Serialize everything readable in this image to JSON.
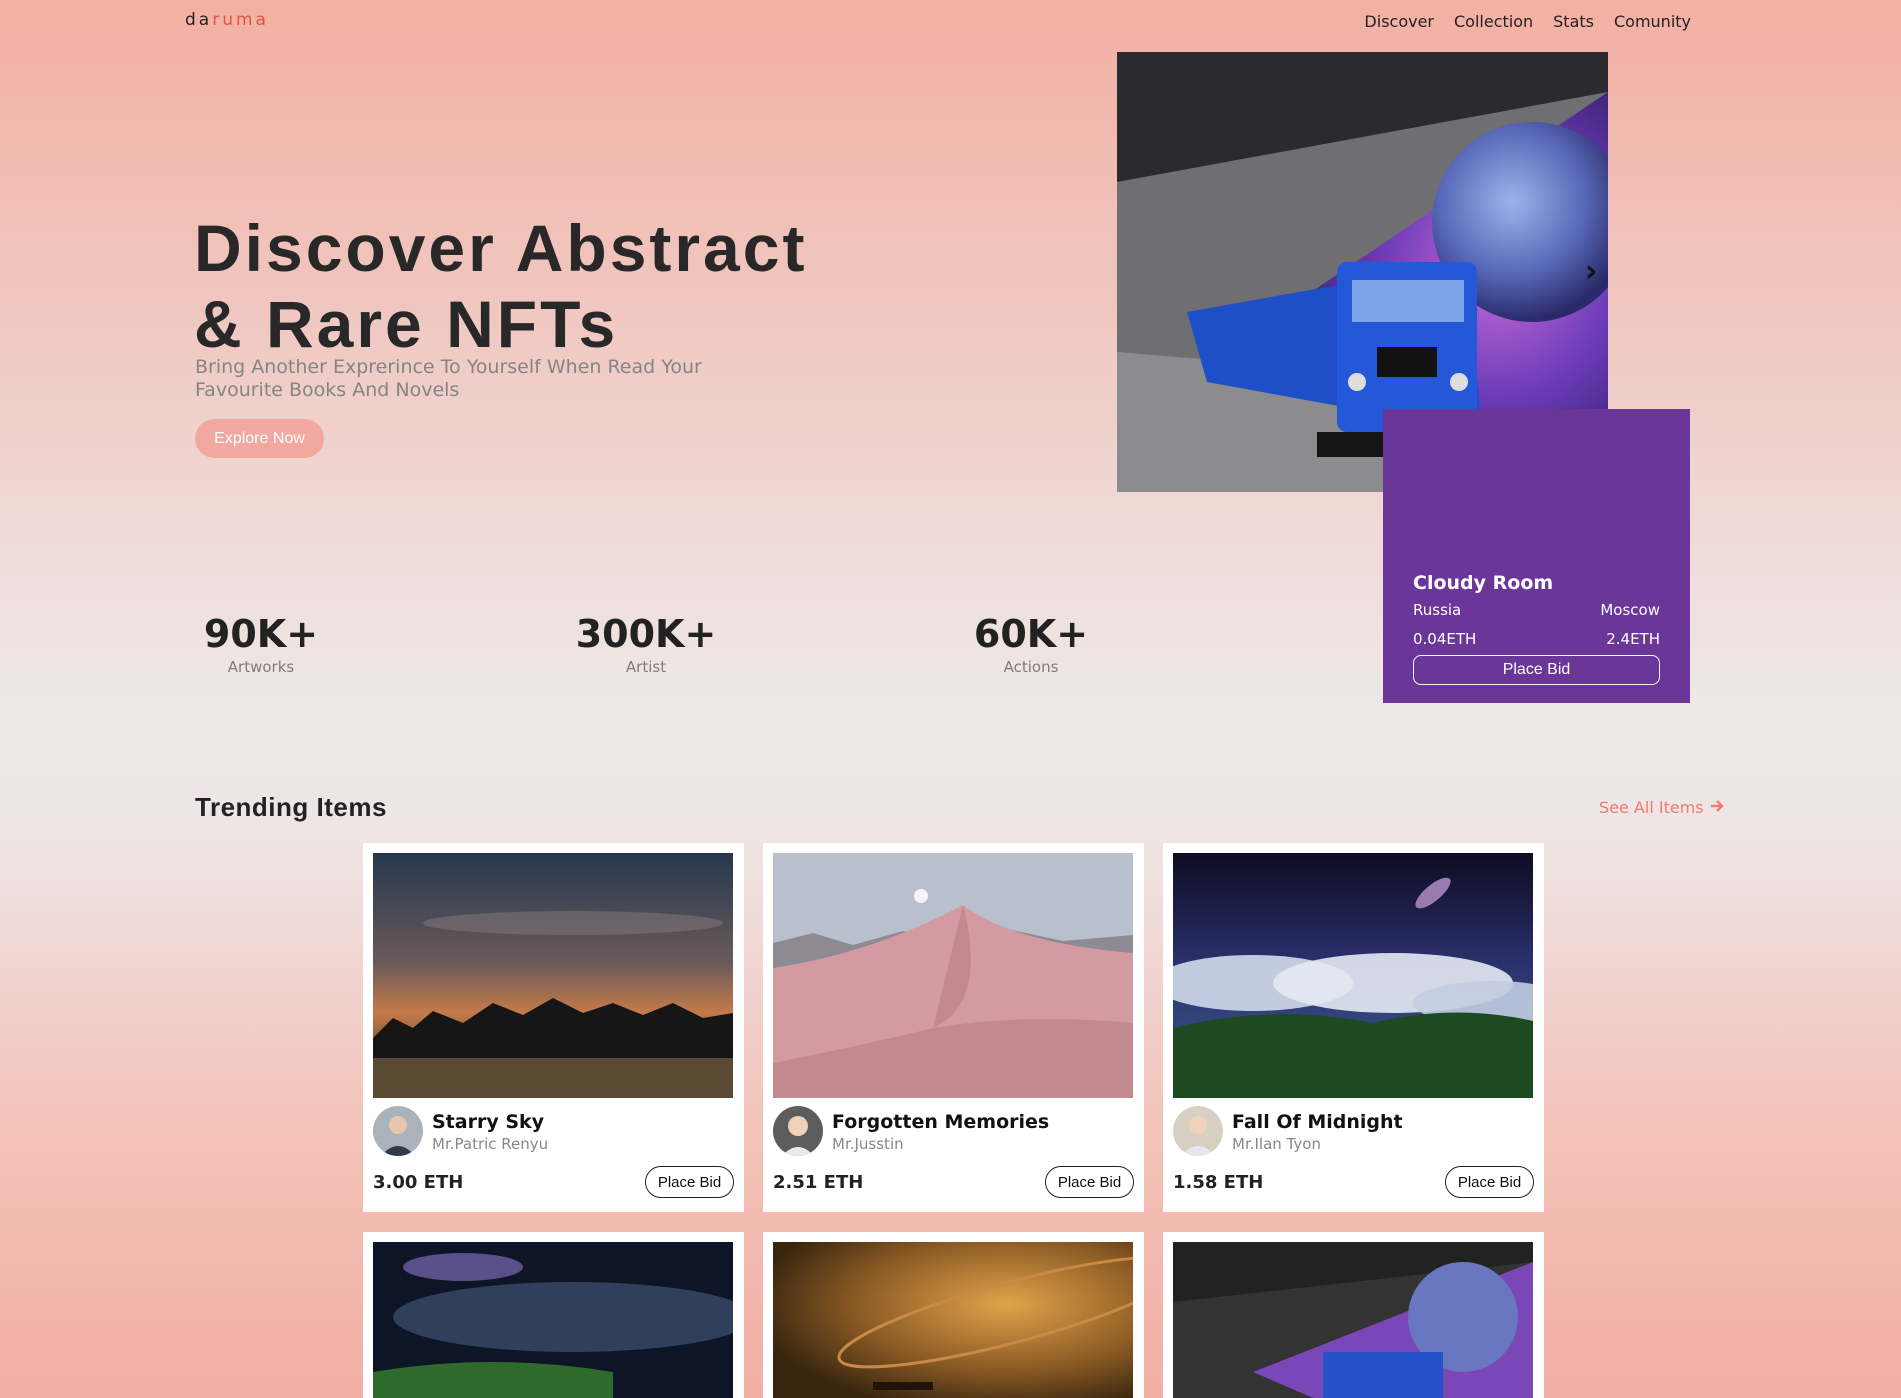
{
  "nav": {
    "logo_part1": "da",
    "logo_part2": "ruma",
    "links": [
      "Discover",
      "Collection",
      "Stats",
      "Comunity"
    ]
  },
  "hero": {
    "title_line1": "Discover Abstract",
    "title_line2": "& Rare NFTs",
    "subtitle_line1": "Bring Another Exprerince To Yourself When Read Your",
    "subtitle_line2": "Favourite Books And Novels",
    "cta": "Explore Now"
  },
  "featured": {
    "title": "Cloudy Room",
    "left_location": "Russia",
    "right_location": "Moscow",
    "left_price": "0.04ETH",
    "right_price": "2.4ETH",
    "bid_label": "Place Bid",
    "accent_color": "#6a3799"
  },
  "stats": [
    {
      "value": "90K+",
      "label": "Artworks"
    },
    {
      "value": "300K+",
      "label": "Artist"
    },
    {
      "value": "60K+",
      "label": "Actions"
    }
  ],
  "trending": {
    "title": "Trending Items",
    "see_all": "See All Items",
    "items": [
      {
        "name": "Starry Sky",
        "artist": "Mr.Patric Renyu",
        "price": "3.00 ETH",
        "bid": "Place Bid"
      },
      {
        "name": "Forgotten Memories",
        "artist": "Mr.Jusstin",
        "price": "2.51 ETH",
        "bid": "Place Bid"
      },
      {
        "name": "Fall Of Midnight",
        "artist": "Mr.Ilan Tyon",
        "price": "1.58 ETH",
        "bid": "Place Bid"
      }
    ]
  },
  "icons": {
    "next": "chevron-right-icon",
    "see_all": "arrow-right-icon"
  },
  "colors": {
    "brand": "#e2543a",
    "cta": "#f2a89e",
    "link": "#ef7a6a"
  }
}
